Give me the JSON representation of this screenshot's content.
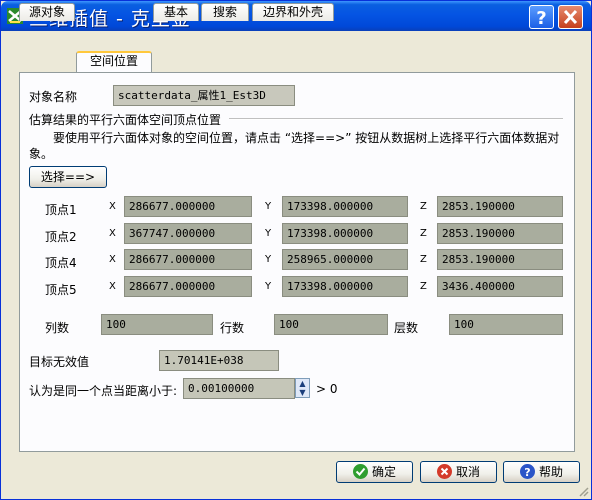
{
  "window": {
    "title": "三维插值 - 克里金"
  },
  "tabs": [
    "源对象",
    "空间位置",
    "基本",
    "搜索",
    "边界和外壳"
  ],
  "object_name": {
    "label": "对象名称",
    "value": "scatterdata_属性1_Est3D"
  },
  "section": {
    "title": "估算结果的平行六面体空间顶点位置",
    "hint_line1": "要使用平行六面体对象的空间位置，请点击 “选择==>” 按钮从数据树上选择平行六面体数据对",
    "hint_line2": "象。",
    "select_button": "选择==>"
  },
  "axes": {
    "x": "X",
    "y": "Y",
    "z": "Z"
  },
  "vertices": [
    {
      "label": "顶点1",
      "x": "286677.000000",
      "y": "173398.000000",
      "z": "2853.190000"
    },
    {
      "label": "顶点2",
      "x": "367747.000000",
      "y": "173398.000000",
      "z": "2853.190000"
    },
    {
      "label": "顶点4",
      "x": "286677.000000",
      "y": "258965.000000",
      "z": "2853.190000"
    },
    {
      "label": "顶点5",
      "x": "286677.000000",
      "y": "173398.000000",
      "z": "3436.400000"
    }
  ],
  "grid": {
    "cols_label": "列数",
    "cols_value": "100",
    "rows_label": "行数",
    "rows_value": "100",
    "layers_label": "层数",
    "layers_value": "100"
  },
  "nodata": {
    "label": "目标无效值",
    "value": "1.70141E+038"
  },
  "tolerance": {
    "label": "认为是同一个点当距离小于:",
    "value": "0.00100000",
    "suffix": "> 0"
  },
  "buttons": {
    "ok": "确定",
    "cancel": "取消",
    "help": "帮助"
  }
}
